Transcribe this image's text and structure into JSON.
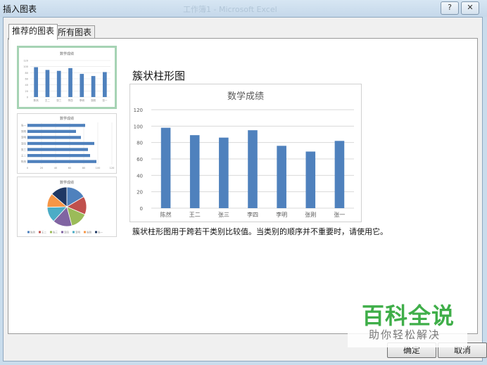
{
  "window": {
    "title": "插入图表",
    "help_label": "?",
    "close_label": "✕",
    "background_title": "工作簿1 - Microsoft Excel"
  },
  "tabs": [
    {
      "label": "推荐的图表",
      "active": true
    },
    {
      "label": "所有图表",
      "active": false
    }
  ],
  "thumbnails": [
    {
      "name": "clustered-column",
      "title": "数学成绩",
      "selected": true
    },
    {
      "name": "clustered-bar",
      "title": "数学成绩",
      "selected": false
    },
    {
      "name": "pie",
      "title": "数学成绩",
      "selected": false
    }
  ],
  "preview": {
    "heading": "簇状柱形图",
    "description": "簇状柱形图用于跨若干类别比较值。当类别的顺序并不重要时，请使用它。"
  },
  "buttons": {
    "ok": "确定",
    "cancel": "取消"
  },
  "watermark": {
    "brand": "百科全说",
    "slogan": "助你轻松解决"
  },
  "colors": {
    "bar": "#4f81bd",
    "selected_border": "#a6d3b4",
    "pie": [
      "#4f81bd",
      "#c0504d",
      "#9bbb59",
      "#8064a2",
      "#4bacc6",
      "#f79646",
      "#1f3864"
    ]
  },
  "chart_data": {
    "type": "bar",
    "title": "数学成绩",
    "categories": [
      "陈然",
      "王二",
      "张三",
      "李四",
      "李明",
      "张刚",
      "张一"
    ],
    "values": [
      98,
      89,
      86,
      95,
      76,
      69,
      82
    ],
    "yticks": [
      "0",
      "20",
      "40",
      "60",
      "80",
      "100",
      "120"
    ],
    "ylim": [
      0,
      120
    ],
    "grid": true,
    "xlabel": "",
    "ylabel": ""
  }
}
